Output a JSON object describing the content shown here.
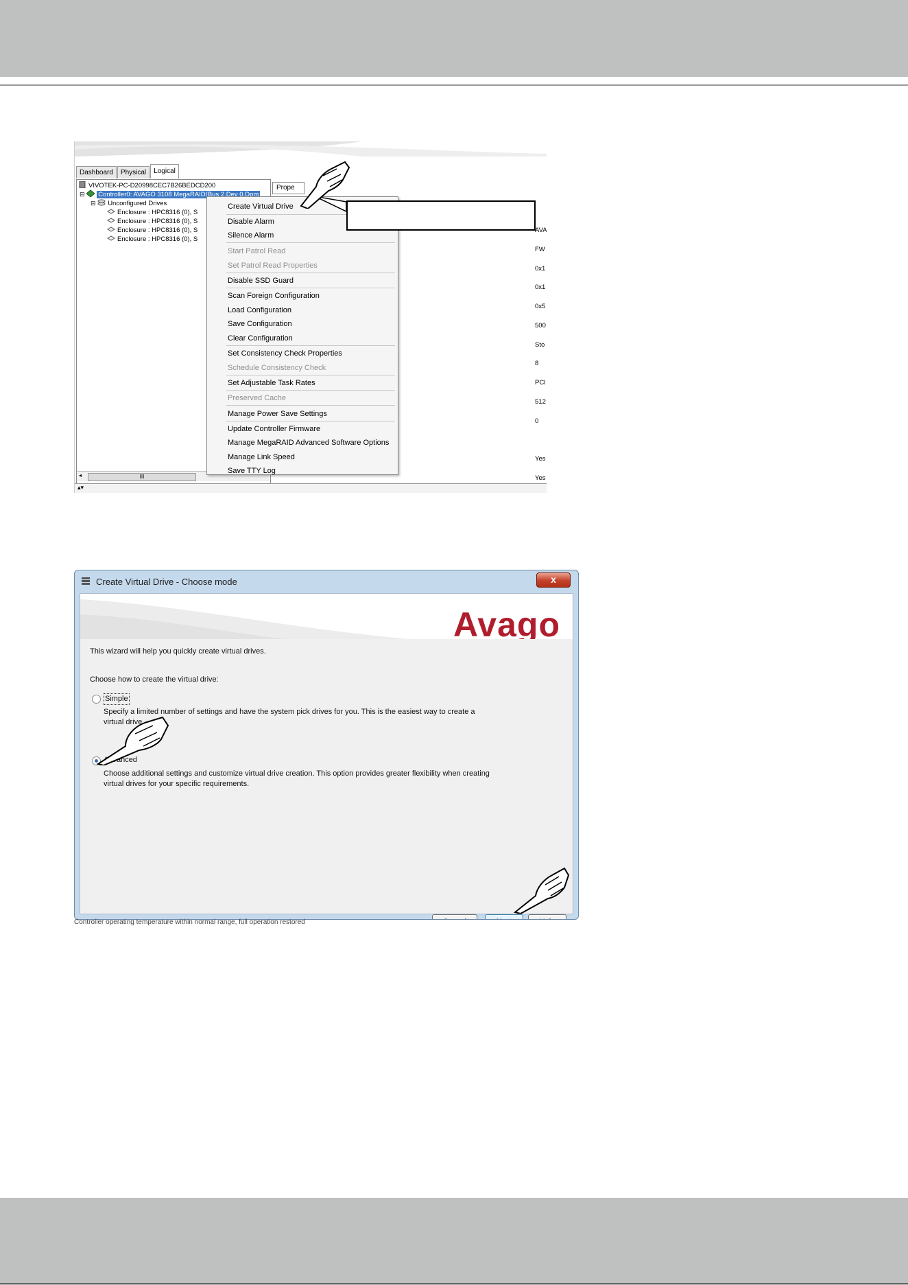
{
  "screen1": {
    "tabs": [
      "Dashboard",
      "Physical",
      "Logical"
    ],
    "tree": {
      "host": "VIVOTEK-PC-D20998CEC7B26BEDCD200",
      "controller": "Controller0: AVAGO 3108 MegaRAID(Bus 2,Dev 0,Dom",
      "unconfigured": "Unconfigured Drives",
      "enclosures": [
        "Enclosure : HPC8316 (0), S",
        "Enclosure : HPC8316 (0), S",
        "Enclosure : HPC8316 (0), S",
        "Enclosure : HPC8316 (0), S"
      ]
    },
    "properties_tab": "Prope",
    "right_values": [
      "AVA",
      "FW",
      "0x1",
      "0x1",
      "0x5",
      "500",
      "Sto",
      "8",
      "PCI",
      "512",
      "0",
      "Yes",
      "Yes"
    ],
    "scroll_glyph": "III",
    "context_menu": [
      {
        "label": "Create Virtual Drive",
        "disabled": false
      },
      {
        "label": "Disable Alarm",
        "disabled": false
      },
      {
        "label": "Silence Alarm",
        "disabled": false
      },
      {
        "label": "Start Patrol Read",
        "disabled": true
      },
      {
        "label": "Set Patrol Read Properties",
        "disabled": true
      },
      {
        "label": "Disable SSD Guard",
        "disabled": false
      },
      {
        "label": "Scan Foreign Configuration",
        "disabled": false
      },
      {
        "label": "Load Configuration",
        "disabled": false
      },
      {
        "label": "Save Configuration",
        "disabled": false
      },
      {
        "label": "Clear Configuration",
        "disabled": false
      },
      {
        "label": "Set Consistency Check Properties",
        "disabled": false
      },
      {
        "label": "Schedule Consistency Check",
        "disabled": true
      },
      {
        "label": "Set Adjustable Task Rates",
        "disabled": false
      },
      {
        "label": "Preserved Cache",
        "disabled": true
      },
      {
        "label": "Manage Power Save Settings",
        "disabled": false
      },
      {
        "label": "Update Controller Firmware",
        "disabled": false
      },
      {
        "label": "Manage MegaRAID Advanced Software Options",
        "disabled": false
      },
      {
        "label": "Manage Link Speed",
        "disabled": false
      },
      {
        "label": "Save TTY Log",
        "disabled": false
      }
    ]
  },
  "screen2": {
    "title": "Create Virtual Drive - Choose mode",
    "close": "x",
    "logo": "Avago",
    "intro": "This wizard will help you quickly create virtual drives.",
    "choose": "Choose how to create the virtual drive:",
    "options": [
      {
        "label": "Simple",
        "desc1": "Specify a limited number of settings and have the system pick drives for you. This is the easiest way to create a",
        "desc2": "virtual drive.",
        "selected": false
      },
      {
        "label": "Advanced",
        "desc1": "Choose additional settings and customize virtual drive creation. This option provides greater flexibility when creating",
        "desc2": "virtual drives for your specific requirements.",
        "selected": true
      }
    ],
    "buttons": {
      "cancel": "Cancel",
      "next": "Next",
      "help": "Help"
    },
    "caption": "Controller operating temperature within normal range, full operation restored"
  }
}
